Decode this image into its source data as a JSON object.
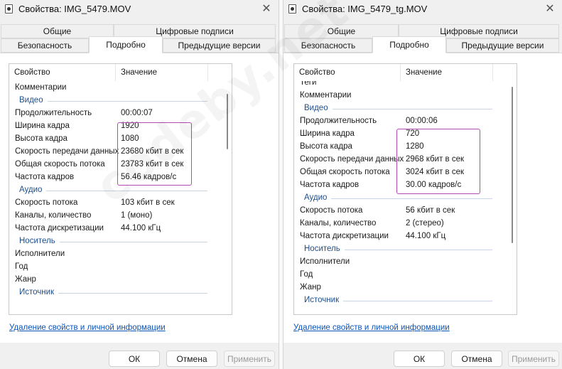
{
  "left": {
    "title": "Свойства: IMG_5479.MOV",
    "tabs_top": [
      "Общие",
      "Цифровые подписи"
    ],
    "tabs_bottom": [
      "Безопасность",
      "Подробно",
      "Предыдущие версии"
    ],
    "active_tab": "Подробно",
    "columns": {
      "name": "Свойство",
      "value": "Значение"
    },
    "rows": [
      {
        "type": "row",
        "name": "Комментарии",
        "value": ""
      },
      {
        "type": "section",
        "name": "Видео"
      },
      {
        "type": "row",
        "name": "Продолжительность",
        "value": "00:00:07"
      },
      {
        "type": "row",
        "name": "Ширина кадра",
        "value": "1920"
      },
      {
        "type": "row",
        "name": "Высота кадра",
        "value": "1080"
      },
      {
        "type": "row",
        "name": "Скорость передачи данных",
        "value": "23680 кбит в сек"
      },
      {
        "type": "row",
        "name": "Общая скорость потока",
        "value": "23783 кбит в сек"
      },
      {
        "type": "row",
        "name": "Частота кадров",
        "value": "56.46 кадров/с"
      },
      {
        "type": "section",
        "name": "Аудио"
      },
      {
        "type": "row",
        "name": "Скорость потока",
        "value": "103 кбит в сек"
      },
      {
        "type": "row",
        "name": "Каналы, количество",
        "value": "1 (моно)"
      },
      {
        "type": "row",
        "name": "Частота дискретизации",
        "value": "44.100 кГц"
      },
      {
        "type": "section",
        "name": "Носитель"
      },
      {
        "type": "row",
        "name": "Исполнители",
        "value": ""
      },
      {
        "type": "row",
        "name": "Год",
        "value": ""
      },
      {
        "type": "row",
        "name": "Жанр",
        "value": ""
      },
      {
        "type": "section",
        "name": "Источник"
      }
    ],
    "link": "Удаление свойств и личной информации",
    "buttons": {
      "ok": "ОК",
      "cancel": "Отмена",
      "apply": "Применить"
    }
  },
  "right": {
    "title": "Свойства: IMG_5479_tg.MOV",
    "tabs_top": [
      "Общие",
      "Цифровые подписи"
    ],
    "tabs_bottom": [
      "Безопасность",
      "Подробно",
      "Предыдущие версии"
    ],
    "active_tab": "Подробно",
    "columns": {
      "name": "Свойство",
      "value": "Значение"
    },
    "rows": [
      {
        "type": "row",
        "name": "Теги",
        "value": ""
      },
      {
        "type": "row",
        "name": "Комментарии",
        "value": ""
      },
      {
        "type": "section",
        "name": "Видео"
      },
      {
        "type": "row",
        "name": "Продолжительность",
        "value": "00:00:06"
      },
      {
        "type": "row",
        "name": "Ширина кадра",
        "value": "720"
      },
      {
        "type": "row",
        "name": "Высота кадра",
        "value": "1280"
      },
      {
        "type": "row",
        "name": "Скорость передачи данных",
        "value": "2968 кбит в сек"
      },
      {
        "type": "row",
        "name": "Общая скорость потока",
        "value": "3024 кбит в сек"
      },
      {
        "type": "row",
        "name": "Частота кадров",
        "value": "30.00 кадров/с"
      },
      {
        "type": "section",
        "name": "Аудио"
      },
      {
        "type": "row",
        "name": "Скорость потока",
        "value": "56 кбит в сек"
      },
      {
        "type": "row",
        "name": "Каналы, количество",
        "value": "2 (стерео)"
      },
      {
        "type": "row",
        "name": "Частота дискретизации",
        "value": "44.100 кГц"
      },
      {
        "type": "section",
        "name": "Носитель"
      },
      {
        "type": "row",
        "name": "Исполнители",
        "value": ""
      },
      {
        "type": "row",
        "name": "Год",
        "value": ""
      },
      {
        "type": "row",
        "name": "Жанр",
        "value": ""
      },
      {
        "type": "section",
        "name": "Источник"
      }
    ],
    "link": "Удаление свойств и личной информации",
    "buttons": {
      "ok": "ОК",
      "cancel": "Отмена",
      "apply": "Применить"
    }
  },
  "watermark": "codeby.net",
  "colors": {
    "highlight_box": "#b14ab1",
    "section_header": "#1e4e8c",
    "link": "#0a54b7"
  },
  "icons": [
    "window-app-icon",
    "close-icon"
  ]
}
